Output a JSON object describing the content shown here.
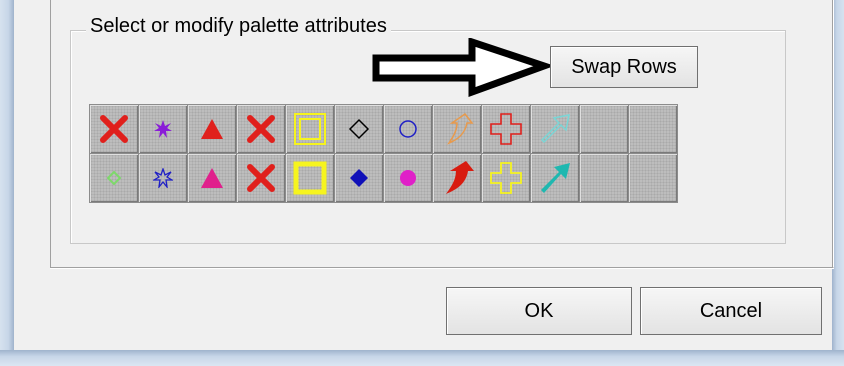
{
  "palette_group": {
    "title": "Select or modify palette attributes"
  },
  "swap_button": {
    "label": "Swap Rows"
  },
  "buttons": {
    "ok_label": "OK",
    "cancel_label": "Cancel"
  },
  "palette": {
    "row_1": [
      {
        "icon": "x-icon",
        "color": "#e0201c"
      },
      {
        "icon": "star-icon",
        "color": "#8a1cd8"
      },
      {
        "icon": "triangle-icon",
        "color": "#e0201c"
      },
      {
        "icon": "x-icon",
        "color": "#e0201c"
      },
      {
        "icon": "double-square-icon",
        "color": "#f6f41e"
      },
      {
        "icon": "diamond-outline-icon",
        "color": "#000000"
      },
      {
        "icon": "circle-outline-icon",
        "color": "#1f1fc6"
      },
      {
        "icon": "curved-arrow-outline-icon",
        "color": "#e89a4c"
      },
      {
        "icon": "cross-outline-icon",
        "color": "#e0201c"
      },
      {
        "icon": "arrow-outline-icon",
        "color": "#7ad6d6"
      }
    ],
    "row_2": [
      {
        "icon": "small-diamond-icon",
        "color": "#7dd86a"
      },
      {
        "icon": "star-outline-icon",
        "color": "#1f1fc6"
      },
      {
        "icon": "triangle-icon",
        "color": "#e0208c"
      },
      {
        "icon": "x-icon",
        "color": "#e0201c"
      },
      {
        "icon": "square-outline-icon",
        "color": "#f6f41e"
      },
      {
        "icon": "diamond-icon",
        "color": "#1010b8"
      },
      {
        "icon": "circle-icon",
        "color": "#e020c8"
      },
      {
        "icon": "curved-arrow-icon",
        "color": "#d81c10"
      },
      {
        "icon": "cross-outline-icon",
        "color": "#f6f41e"
      },
      {
        "icon": "arrow-icon",
        "color": "#1fb8b0"
      }
    ]
  }
}
